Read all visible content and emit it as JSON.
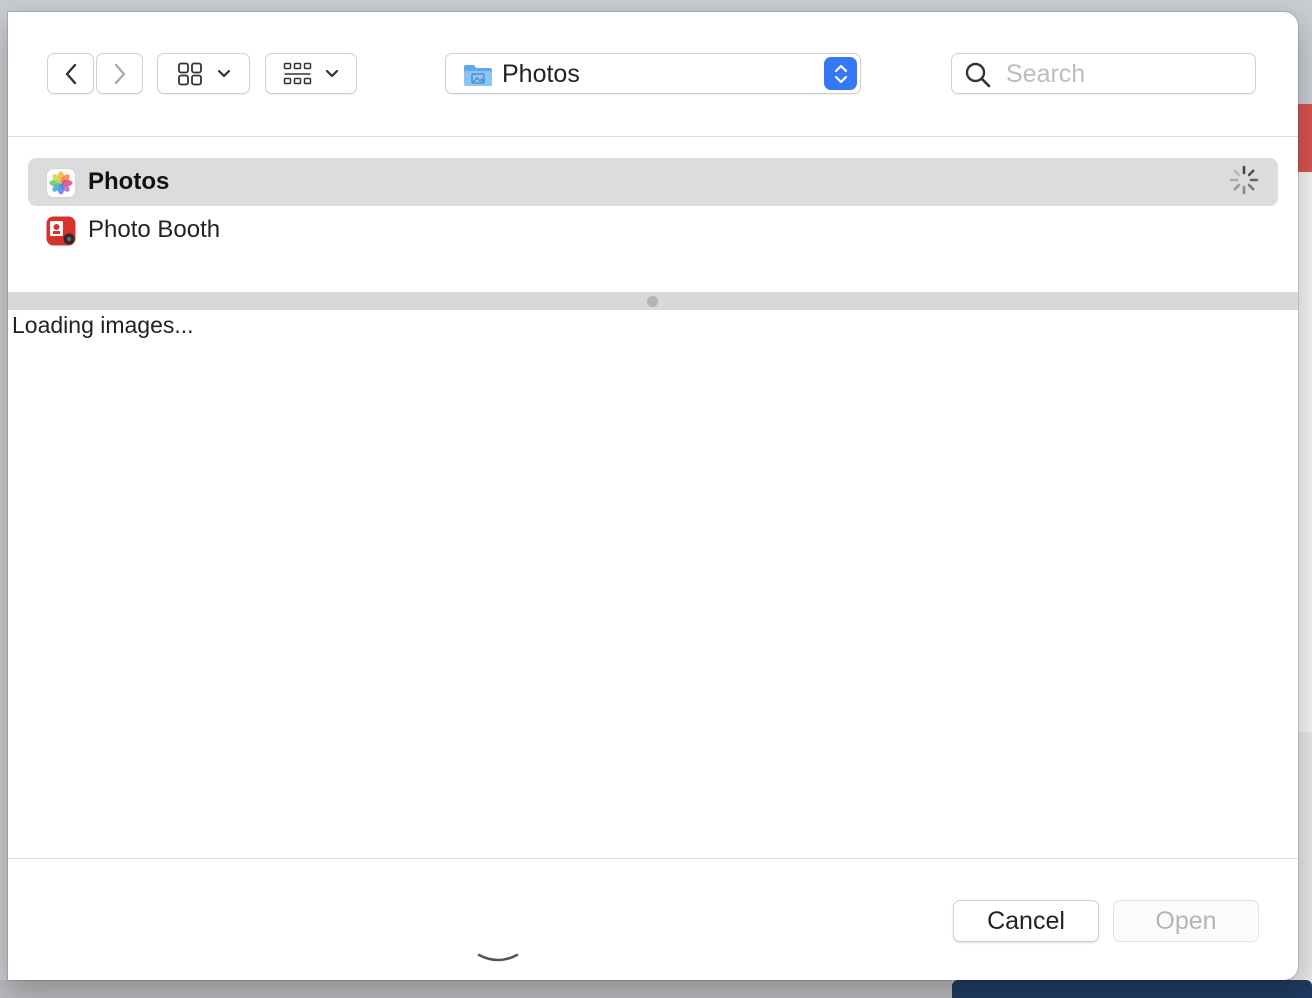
{
  "dialog": {
    "location": {
      "label": "Photos",
      "icon": "folder-icon"
    },
    "search": {
      "placeholder": "Search",
      "value": ""
    },
    "toolbar": {
      "back_icon": "chevron-left-icon",
      "forward_icon": "chevron-right-icon",
      "view_icon": "grid-view-icon",
      "group_icon": "group-view-icon"
    },
    "sources": [
      {
        "label": "Photos",
        "icon": "photos-app-icon",
        "selected": true,
        "loading": true
      },
      {
        "label": "Photo Booth",
        "icon": "photo-booth-app-icon",
        "selected": false
      }
    ],
    "status_text": "Loading images...",
    "buttons": {
      "cancel": "Cancel",
      "open": "Open",
      "open_enabled": false
    }
  },
  "colors": {
    "accent": "#3478f6",
    "selection": "#dcdcdc",
    "splitter": "#d8d8d8"
  }
}
